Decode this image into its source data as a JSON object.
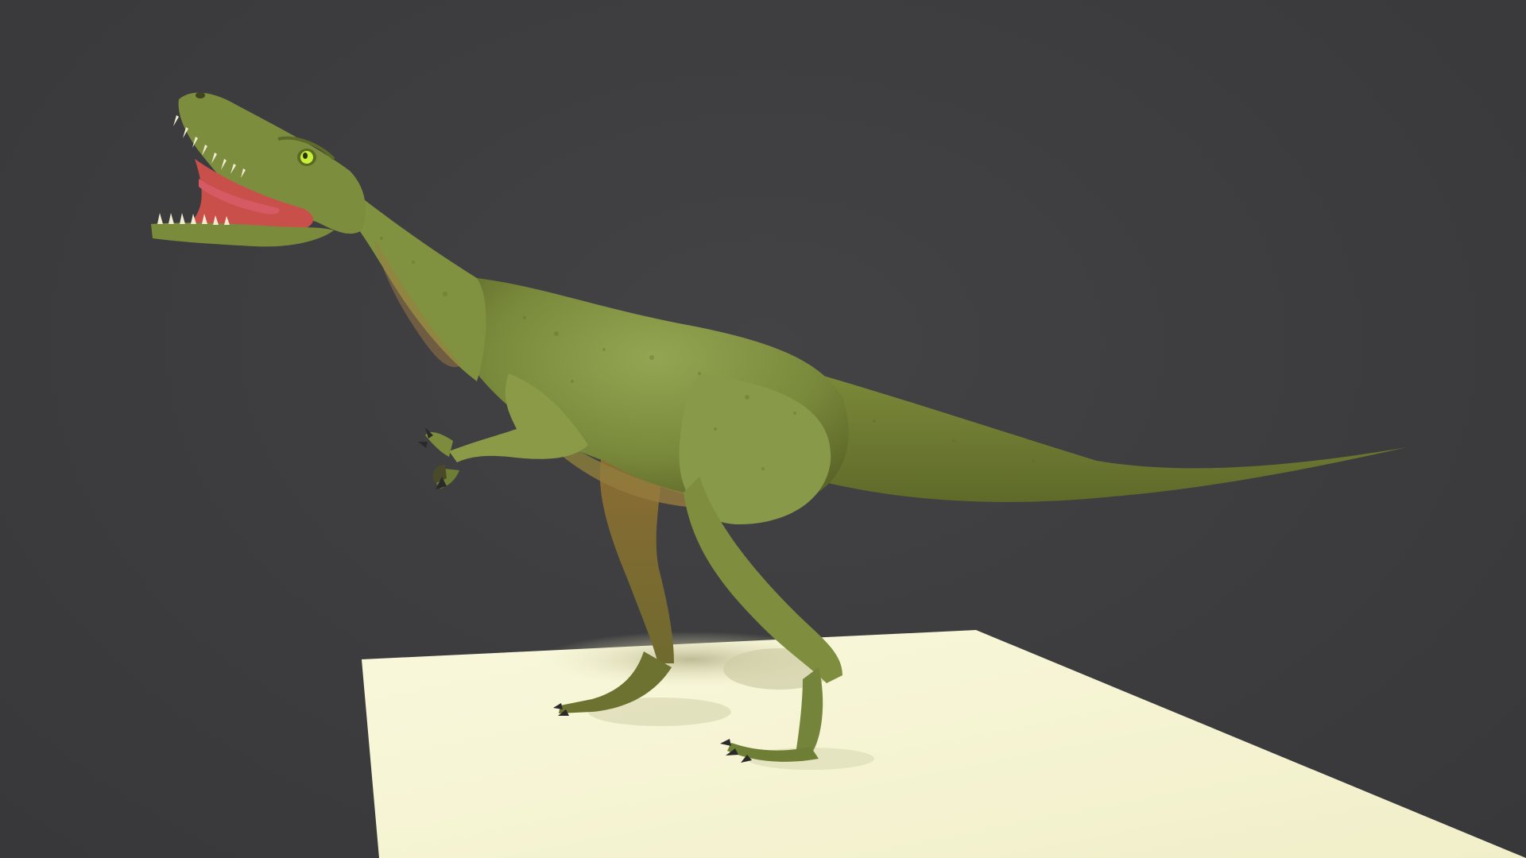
{
  "scene": {
    "subject": "raptor-dinosaur-model",
    "colors": {
      "background": "#3d3d3f",
      "ground_plane": "#f7f5d4",
      "skin_light": "#8a9a4a",
      "skin_dark": "#5e6a2a",
      "belly": "#a07a40",
      "mouth": "#c9504a",
      "tongue": "#d4505a",
      "teeth": "#f2ecd0",
      "eye": "#c8f03a",
      "claws": "#2a2a2a"
    }
  }
}
